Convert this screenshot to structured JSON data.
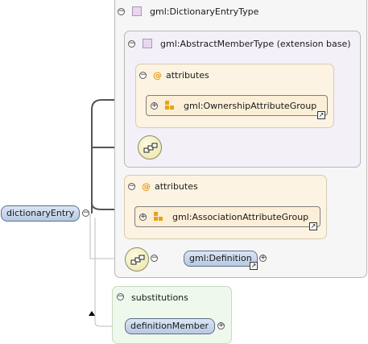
{
  "diagram": {
    "root_element": {
      "name": "dictionaryEntry"
    },
    "type_box": {
      "name": "gml:DictionaryEntryType"
    },
    "base_box": {
      "name": "gml:AbstractMemberType (extension base)"
    },
    "base_attributes": {
      "label": "attributes",
      "group_ref": "gml:OwnershipAttributeGroup"
    },
    "own_attributes": {
      "label": "attributes",
      "group_ref": "gml:AssociationAttributeGroup"
    },
    "definition_element": {
      "name": "gml:Definition"
    },
    "substitutions": {
      "label": "substitutions",
      "member": "definitionMember"
    },
    "colors": {
      "type_background": "#f5f4fa",
      "attribute_background": "#fdf3e2",
      "substitution_background": "#eff8ec",
      "element_fill": "#c8d7ec",
      "connector": "#555555"
    }
  }
}
